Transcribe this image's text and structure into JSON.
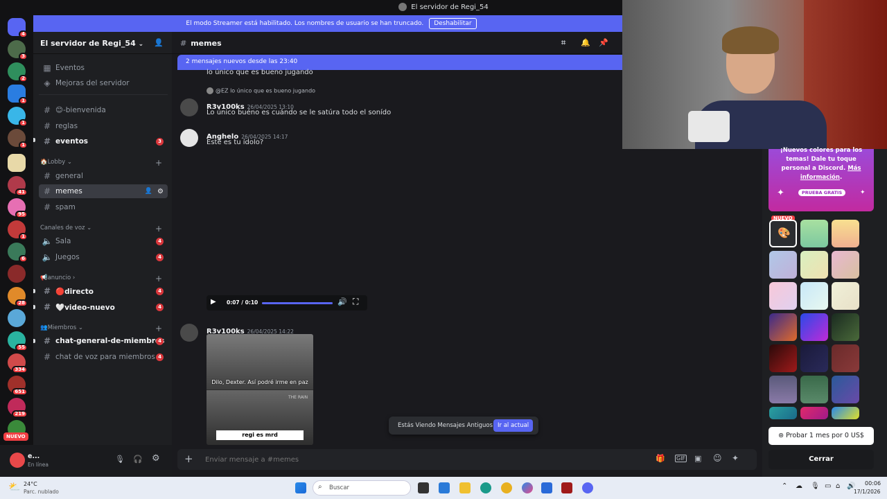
{
  "window": {
    "title": "El servidor de Regi_54"
  },
  "streamer": {
    "notice": "El modo Streamer está habilitado. Los nombres de usuario se han truncado.",
    "disable_label": "Deshabilitar"
  },
  "server_badges": [
    "4",
    "3",
    "2",
    "1",
    "1",
    "1",
    "41",
    "95",
    "1",
    "6",
    "28",
    "55",
    "334",
    "651",
    "219"
  ],
  "nuevo_tag": "NUEVO",
  "server": {
    "name": "El servidor de Regi_54"
  },
  "sidebar": {
    "top_items": [
      "Eventos",
      "Mejoras del servidor"
    ],
    "channels": [
      "😊-bienvenida",
      "reglas",
      "eventos"
    ],
    "eventos_badge": "3",
    "lobby_cat": "Lobby",
    "lobby_channels": [
      "general",
      "memes",
      "spam"
    ],
    "voice_cat": "Canales de voz",
    "voice_channels": [
      "Sala",
      "Juegos"
    ],
    "voice_badges": [
      "4",
      "4"
    ],
    "anuncio_cat": "anuncio",
    "anuncio_channels": [
      "🔴directo",
      "🤍video-nuevo"
    ],
    "anuncio_badges": [
      "4",
      "4"
    ],
    "miembros_cat": "Miembros",
    "miembros_channels": [
      "chat-general-de-miembros",
      "chat de voz para miembros"
    ],
    "miembros_badges": [
      "4",
      "4"
    ]
  },
  "user": {
    "name": "e...",
    "status": "En línea"
  },
  "channel": {
    "name": "memes"
  },
  "new_messages": "2 mensajes nuevos desde las 23:40",
  "messages": {
    "prev_line": "lo único que es bueno jugando",
    "reply_ref": "@EZ lo único que es bueno jugando",
    "m1_author": "R3v100ks",
    "m1_time": "26/04/2025 13:10",
    "m1_text": "Lo único buéno es cuándo se le satúra todo el sonído",
    "m2_author": "Anghelo",
    "m2_time": "26/04/2025 14:17",
    "m2_text": "Este es tu ídolo?",
    "audio_time": "0:07 / 0:10",
    "m3_author": "R3v100ks",
    "m3_time": "26/04/2025 14:22",
    "meme_top": "Dilo, Dexter. Así podré irme en paz",
    "meme_bottom": "regi es mrd",
    "meme_sign": "THE RAIN"
  },
  "old_messages": {
    "text": "Estás Viendo Mensajes Antiguos",
    "jump": "Ir al actual"
  },
  "composer": {
    "placeholder": "Enviar mensaje a #memes"
  },
  "promo": {
    "line1": "¡Nuevos colores para los temas! Dale tu toque personal a Discord.",
    "link": "Más información",
    "trial": "PRUEBA GRATIS",
    "nuevo": "NUEVO",
    "cta": "Probar 1 mes por 0 US$",
    "close": "Cerrar"
  },
  "taskbar": {
    "temp": "24°C",
    "weather": "Parc. nublado",
    "search": "Buscar",
    "time": "00:06",
    "date": "17/1/2026"
  }
}
